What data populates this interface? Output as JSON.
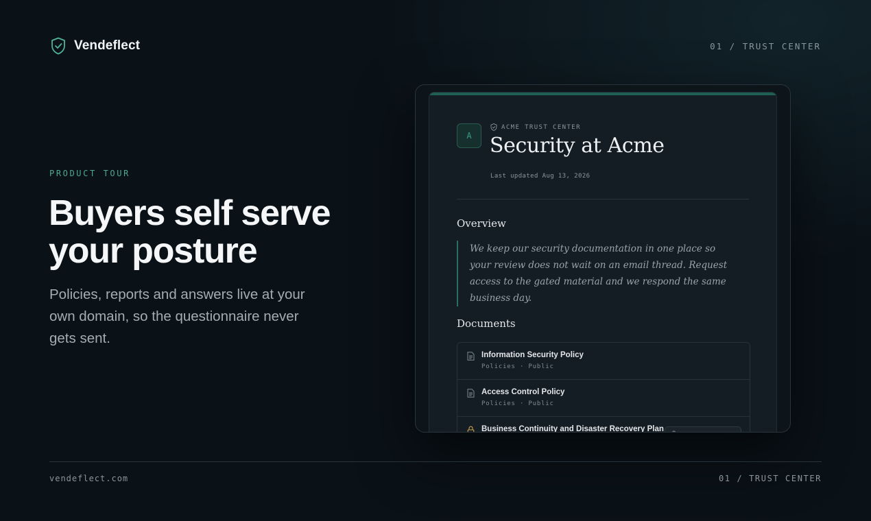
{
  "brand": {
    "name": "Vendeflect",
    "icon": "shield-check-icon"
  },
  "header": {
    "section": "01 / TRUST CENTER"
  },
  "hero": {
    "eyebrow": "PRODUCT TOUR",
    "headline": "Buyers self serve your posture",
    "subtext": "Policies, reports and answers live at your own domain, so the questionnaire never gets sent."
  },
  "trust_center": {
    "avatar_letter": "A",
    "label": "ACME TRUST CENTER",
    "title": "Security at Acme",
    "updated": "Last updated Aug 13, 2026",
    "overview": {
      "heading": "Overview",
      "text": "We keep our security documentation in one place so your review does not wait on an email thread. Request access to the gated material and we respond the same business day."
    },
    "documents": {
      "heading": "Documents",
      "items": [
        {
          "name": "Information Security Policy",
          "meta": "Policies · Public",
          "icon": "document-icon"
        },
        {
          "name": "Access Control Policy",
          "meta": "Policies · Public",
          "icon": "document-icon"
        },
        {
          "name": "Business Continuity and Disaster Recovery Plan",
          "meta": "",
          "icon": "lock-icon"
        }
      ]
    },
    "accent_color": "#1f5f56"
  },
  "footer": {
    "domain": "vendeflect.com",
    "section": "01 / TRUST CENTER"
  }
}
